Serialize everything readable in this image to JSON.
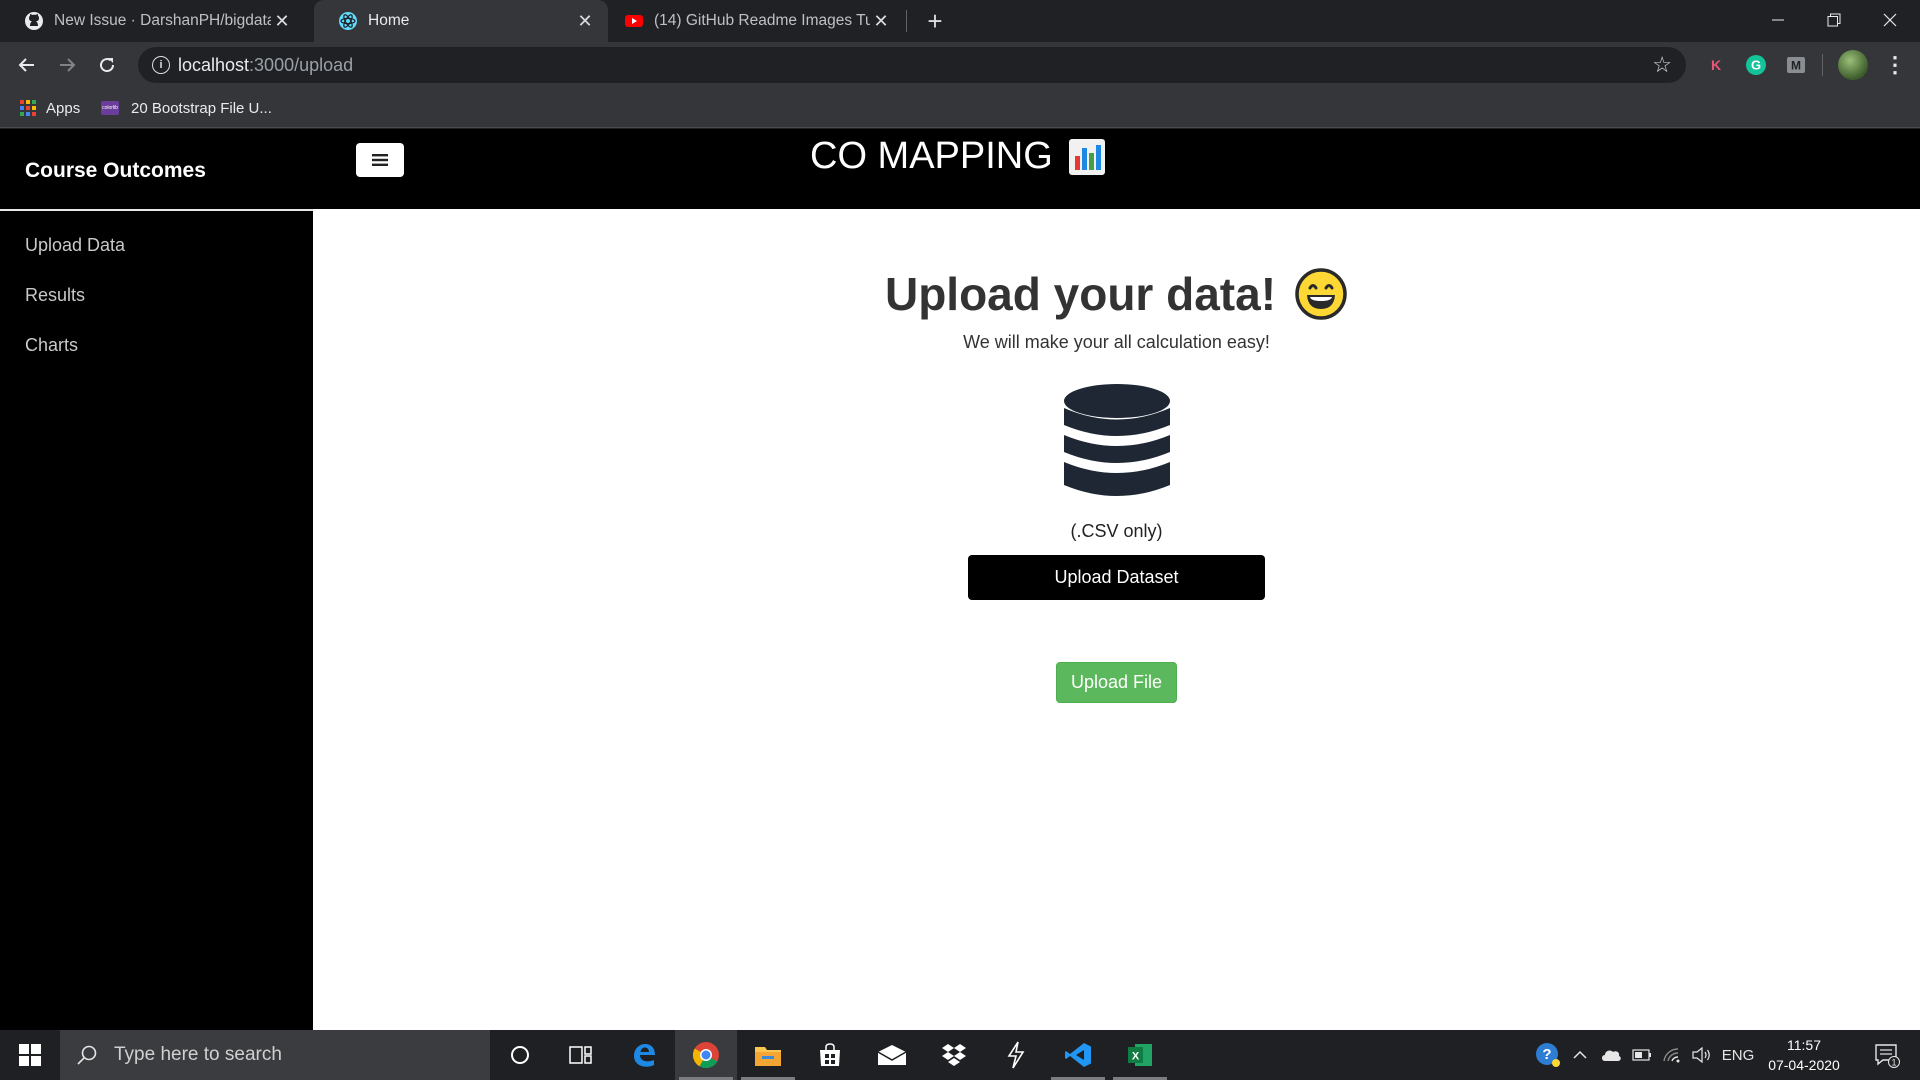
{
  "browser": {
    "tabs": [
      {
        "title": "New Issue · DarshanPH/bigdata",
        "icon": "github-icon"
      },
      {
        "title": "Home",
        "icon": "react-icon"
      },
      {
        "title": "(14) GitHub Readme Images Tuto",
        "icon": "youtube-icon"
      }
    ],
    "url_host": "localhost",
    "url_path": ":3000/upload",
    "bookmarks": [
      {
        "label": "Apps"
      },
      {
        "label": "20 Bootstrap File U..."
      }
    ],
    "extensions": [
      "K",
      "G",
      "M"
    ]
  },
  "page": {
    "brand": "Course Outcomes",
    "site_title": "CO MAPPING",
    "sidebar_links": [
      "Upload Data",
      "Results",
      "Charts"
    ],
    "headline": "Upload your data!",
    "subtitle": "We will make your all calculation easy!",
    "csv_note": "(.CSV only)",
    "upload_dataset_label": "Upload Dataset",
    "upload_file_label": "Upload File",
    "accent_colors": {
      "success": "#5cb85c",
      "dark": "#000000",
      "db_icon": "#1e2733"
    }
  },
  "taskbar": {
    "search_placeholder": "Type here to search",
    "language": "ENG",
    "time": "11:57",
    "date": "07-04-2020",
    "notifications": "1"
  }
}
